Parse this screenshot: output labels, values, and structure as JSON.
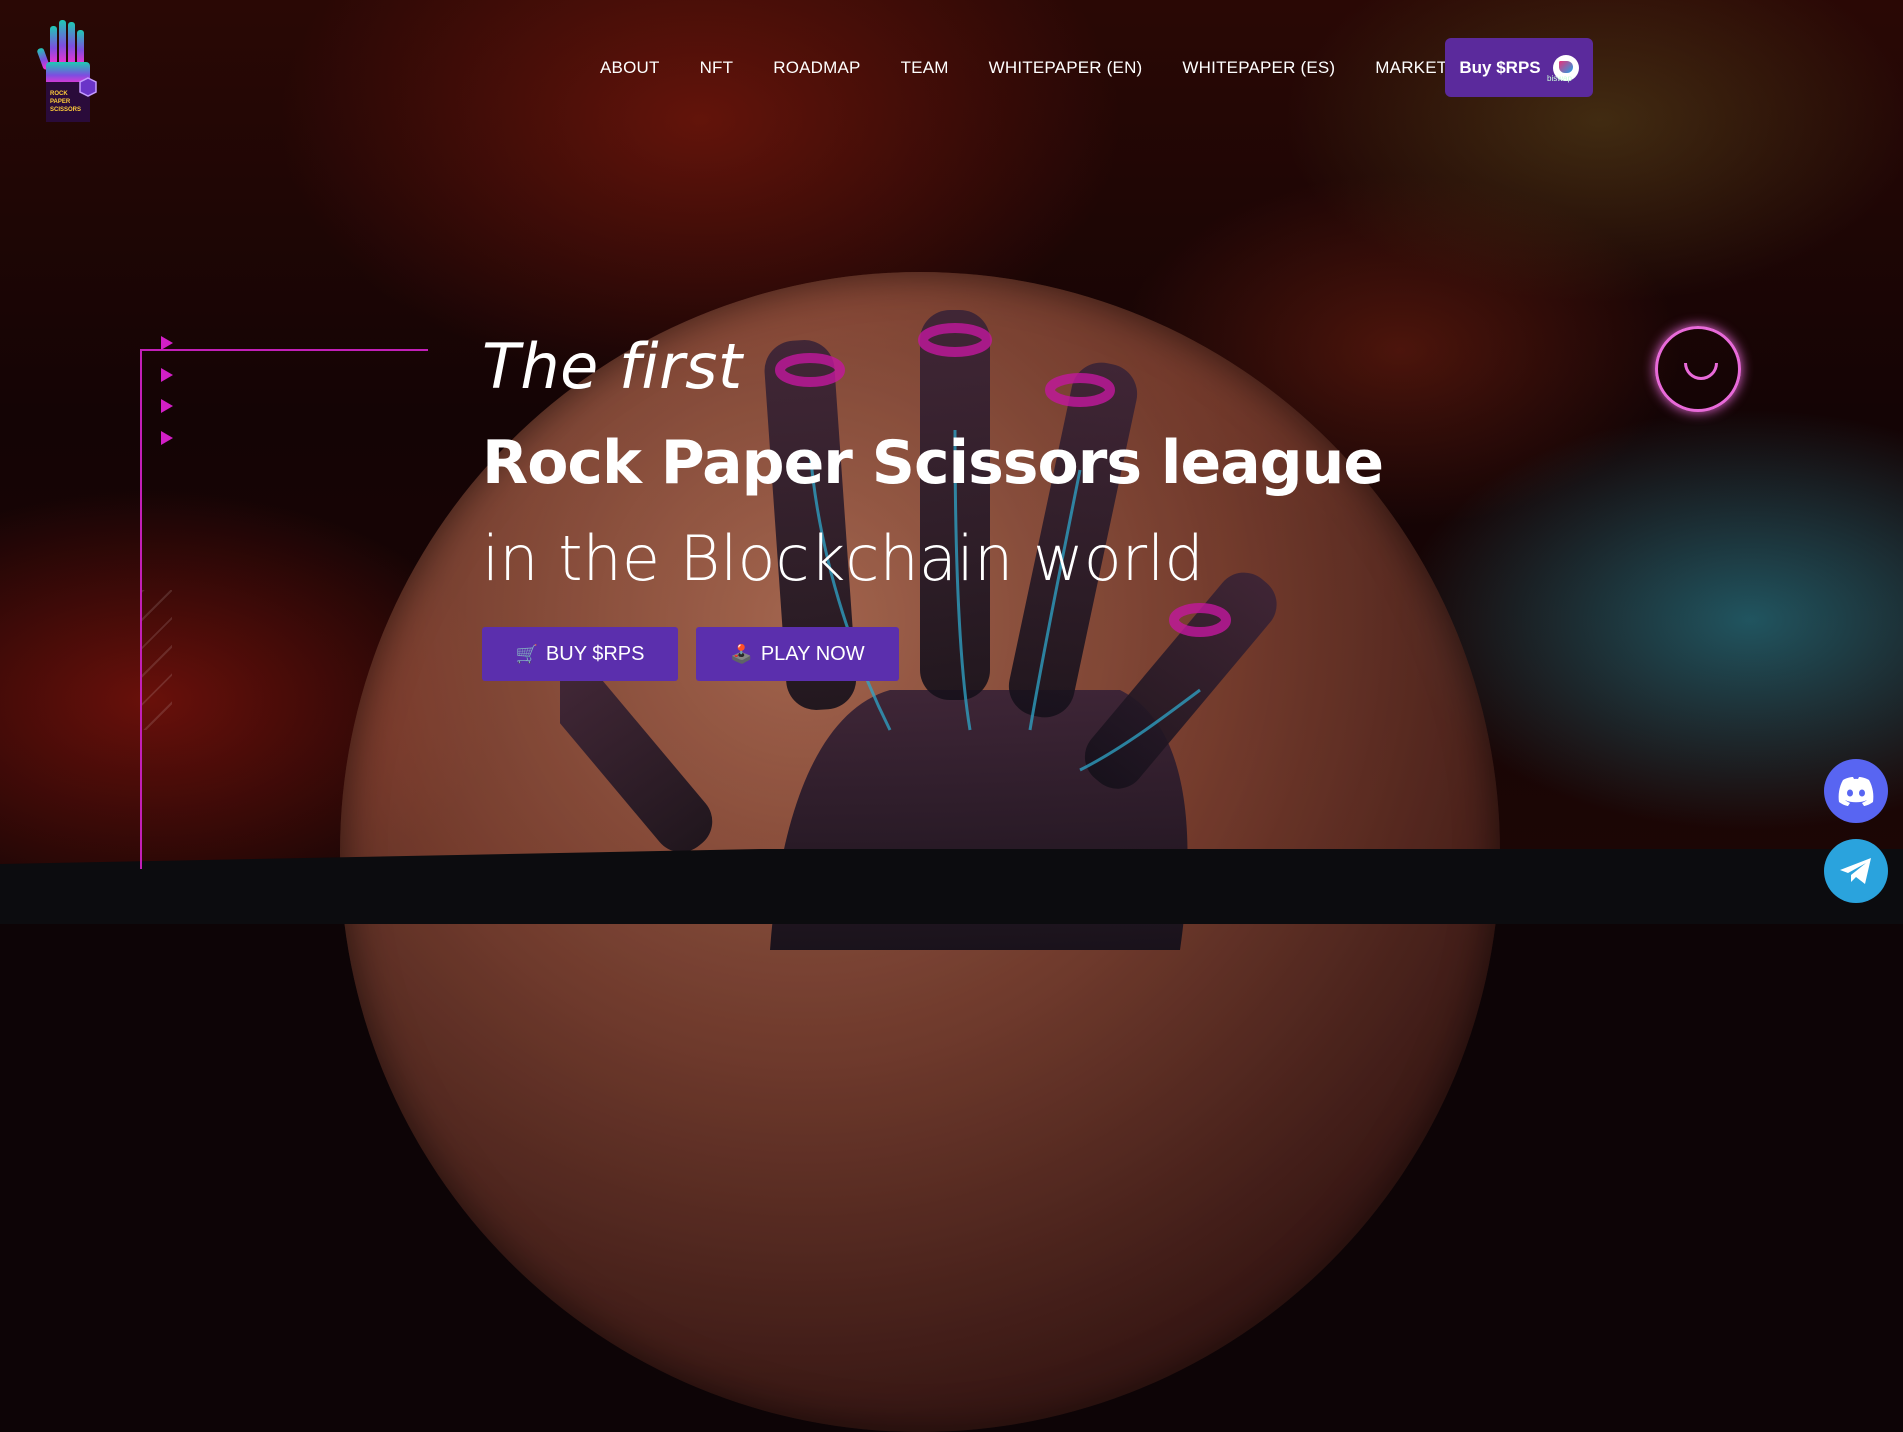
{
  "brand": {
    "logo_text_lines": [
      "ROCK",
      "PAPER",
      "SCISSORS"
    ]
  },
  "nav": {
    "items": [
      {
        "label": "ABOUT"
      },
      {
        "label": "NFT"
      },
      {
        "label": "ROADMAP"
      },
      {
        "label": "TEAM"
      },
      {
        "label": "WHITEPAPER (EN)"
      },
      {
        "label": "WHITEPAPER (ES)"
      },
      {
        "label": "MARKETPLACE"
      }
    ],
    "buy_button": {
      "label": "Buy $RPS",
      "partner": "biswap"
    }
  },
  "hero": {
    "line1": "The first",
    "line2": "Rock Paper Scissors league",
    "line3": "in the Blockchain world",
    "buttons": {
      "buy": {
        "icon": "🛒",
        "label": "BUY $RPS"
      },
      "play": {
        "icon": "🕹️",
        "label": "PLAY NOW"
      }
    }
  },
  "social": {
    "discord_icon": "discord-icon",
    "telegram_icon": "telegram-icon"
  },
  "colors": {
    "accent_purple": "#5b2fad",
    "neon_pink": "#d21fc7",
    "discord": "#5865f2",
    "telegram": "#2aa3dd"
  }
}
